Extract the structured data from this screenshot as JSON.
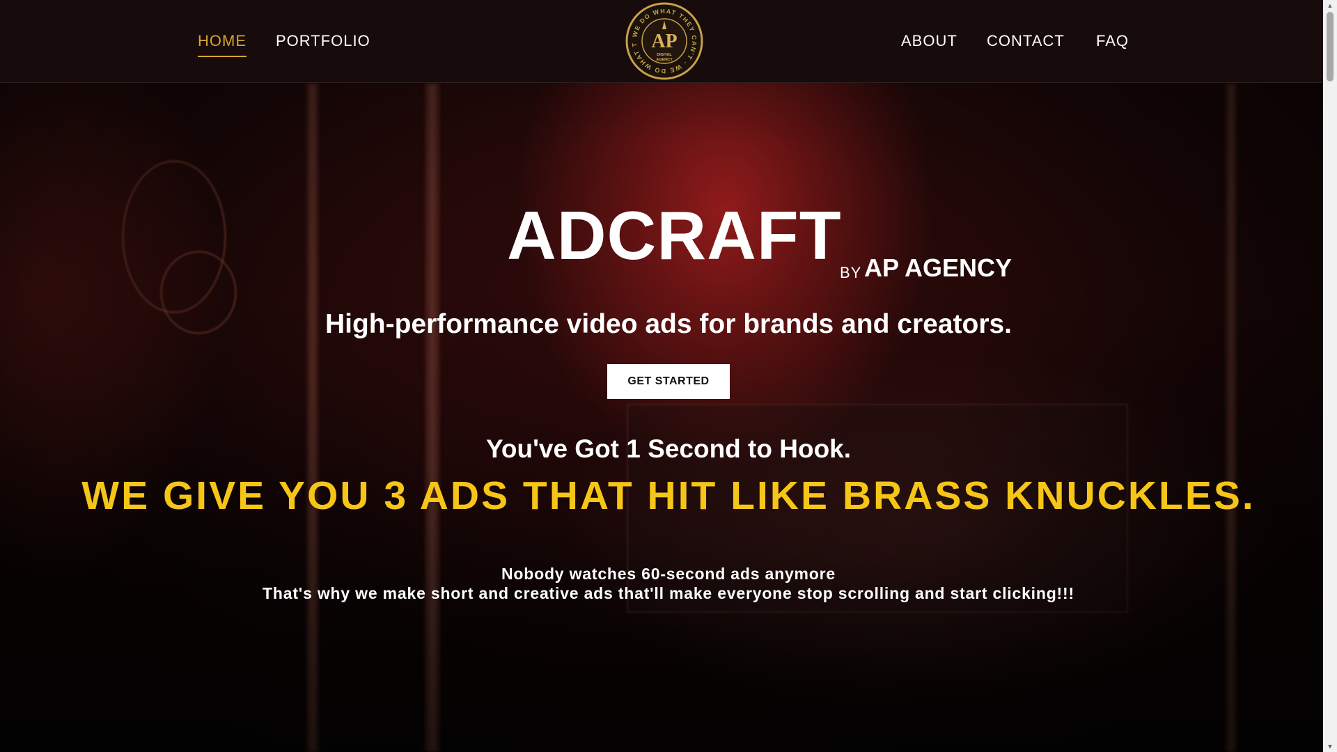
{
  "nav": {
    "left": [
      {
        "label": "HOME",
        "active": true
      },
      {
        "label": "PORTFOLIO",
        "active": false
      }
    ],
    "right": [
      {
        "label": "ABOUT"
      },
      {
        "label": "CONTACT"
      },
      {
        "label": "FAQ"
      }
    ],
    "logo": {
      "ring_text": "WE DO WHAT THEY CAN'T",
      "monogram": "AP",
      "caption_line1": "DIGITAL",
      "caption_line2": "AGENCY",
      "colors": {
        "gold": "#c9a14a",
        "dark": "#1b120d"
      }
    }
  },
  "hero": {
    "title": "ADCRAFT",
    "by": "BY",
    "agency": "AP AGENCY",
    "tagline": "High-performance video ads for brands and creators.",
    "cta_label": "GET STARTED",
    "hook": "You've Got 1 Second to Hook.",
    "punch": "WE GIVE YOU 3 ADS THAT HIT LIKE BRASS KNUCKLES.",
    "body_line1": "Nobody watches 60-second ads anymore",
    "body_line2": "That's why we make short and creative ads that'll make everyone stop scrolling and start clicking!!!"
  },
  "colors": {
    "accent_gold": "#d6a531",
    "punch_yellow": "#f5c518",
    "header_bg": "#170b0b",
    "text": "#ffffff"
  },
  "scrollbar": {
    "up_icon": "triangle-up-icon",
    "down_icon": "triangle-down-icon"
  }
}
